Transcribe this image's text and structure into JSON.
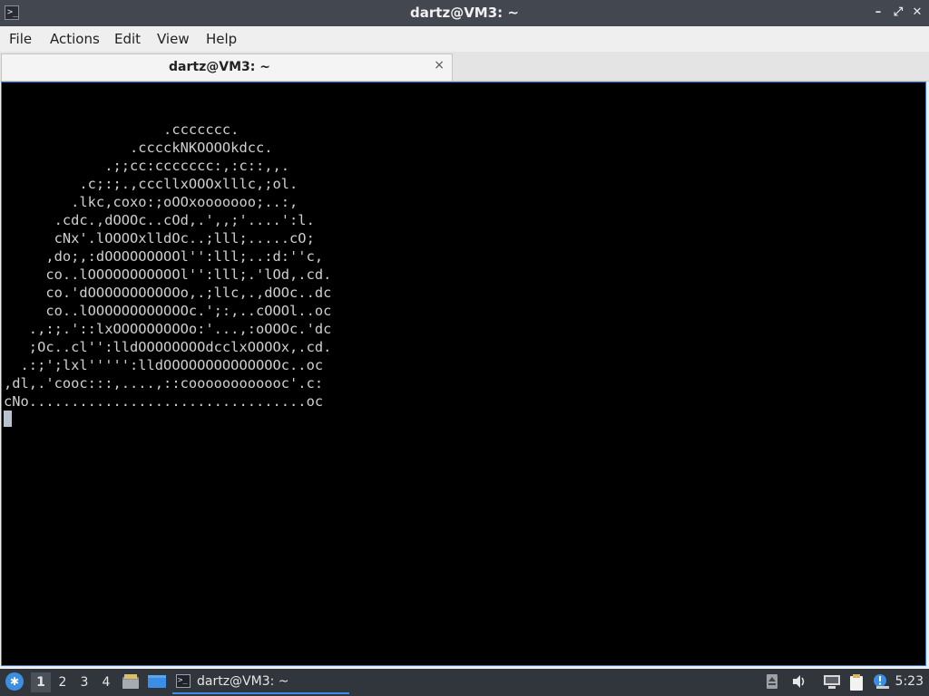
{
  "window": {
    "title": "dartz@VM3: ~",
    "icon": "terminal-icon",
    "controls": [
      "minimize-icon",
      "maximize-icon",
      "close-icon"
    ]
  },
  "menu": {
    "file": "File",
    "actions": "Actions",
    "edit": "Edit",
    "view": "View",
    "help": "Help"
  },
  "tab": {
    "title": "dartz@VM3: ~",
    "close": "×"
  },
  "terminal": {
    "output": "                   .ccccccc.\n               .cccckNKOOOOkdcc.\n            .;;cc:ccccccc:,:c::,,.\n         .c;:;.,cccllxOOOxlllc,;ol.\n        .lkc,coxo:;oOOxooooooo;..:,\n      .cdc.,dOOOc..cOd,.',,;'....':l.\n      cNx'.lOOOOxlldOc..;lll;.....cO;\n     ,do;,:dOOOOOOOOOl'':lll;..:d:''c,\n     co..lOOOOOOOOOOOl'':lll;.'lOd,.cd.\n     co.'dOOOOOOOOOOOo,.;llc,.,dOOc..dc\n     co..lOOOOOOOOOOOOc.';:,..cOOOl..oc\n   .,:;.'::lxOOOOOOOOOo:'...,:oOOOc.'dc\n   ;Oc..cl'':lldOOOOOOOOdcclxOOOOx,.cd.\n  .:;';lxl''''':lldOOOOOOOOOOOOOOc..oc\n,dl,.'cooc:::,....,::coooooooooooc'.c:\ncNo.................................oc",
    "cursor_color": "#b9c3cf",
    "background": "#000000",
    "foreground": "#cfcfcf"
  },
  "taskbar": {
    "start_icon": "lxqt-start-icon",
    "workspaces": [
      "1",
      "2",
      "3",
      "4"
    ],
    "active_workspace": "1",
    "launchers": [
      "file-manager-icon",
      "show-desktop-icon"
    ],
    "task": {
      "icon": "terminal-icon",
      "label": "dartz@VM3: ~"
    },
    "tray": [
      "removable-media-icon",
      "volume-icon",
      "network-icon",
      "clipboard-icon",
      "notification-icon"
    ],
    "clock": "5:23"
  },
  "colors": {
    "titlebar": "#434750",
    "taskbar": "#31363d",
    "accent": "#3a8ee6"
  }
}
